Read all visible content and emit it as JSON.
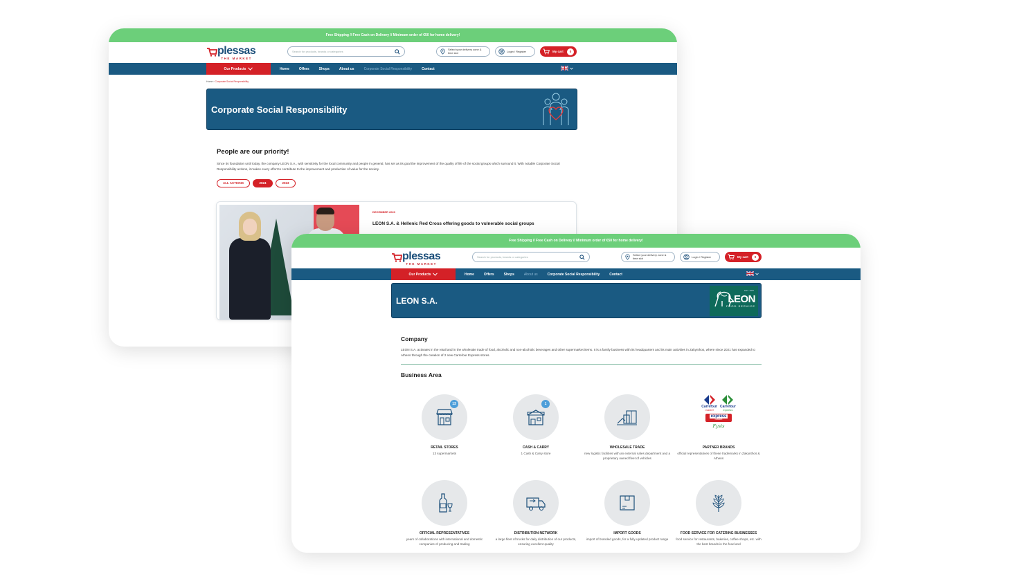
{
  "colors": {
    "promo_green": "#6ccf7a",
    "nav_blue": "#1a5a82",
    "brand_red": "#d42127",
    "badge_blue": "#4d9ed9"
  },
  "header": {
    "promo": "Free Shipping // Free Cash on Delivery // Minimum order of €50 for home delivery!",
    "logo_word": "plessas",
    "logo_sub": "THE MARKET",
    "search_placeholder": "Search for products, brands or categories",
    "delivery_label": "Select your delivery zone & time slot",
    "login_label": "Login / Register",
    "cart_label": "My cart",
    "cart_count": "0"
  },
  "nav": {
    "products": "Our Products",
    "links": [
      "Home",
      "Offers",
      "Shops",
      "About us",
      "Corporate Social Responsibility",
      "Contact"
    ]
  },
  "csr_page": {
    "breadcrumb_home": "Home",
    "breadcrumb_current": "Corporate Social Responsibility",
    "banner_title": "Corporate Social Responsibility",
    "heading": "People are our priority!",
    "intro": "Since its foundation until today, the company LEON S.A., with sensitivity for the local community and people in general, has set as its goal the improvement of the quality of life of the social groups which surround it. With notable Corporate Social Responsibility actions, it makes every effort to contribute to the improvement and production of value for the society.",
    "filters": [
      "ALL ACTIONS",
      "2024",
      "2023"
    ],
    "card_date": "DECEMBER 2023",
    "card_title": "LEON S.A. & Hellenic Red Cross offering goods to vulnerable social groups"
  },
  "leon_page": {
    "banner_title": "LEON S.A.",
    "logo_word": "LEON",
    "logo_sub": "FOOD SERVICE",
    "logo_est": "EST. 1987",
    "company_heading": "Company",
    "company_text": "LEON S.A. activates in the retail and in the wholesale trade of food, alcoholic and non-alcoholic beverages and other supermarket items. It is a family business with its headquarters and its main activities in Zakynthos, where since 2021 has expanded to Athens through the creation of 2 new Carrefour Express stores.",
    "business_heading": "Business Area",
    "items": [
      {
        "label": "RETAIL STORES",
        "desc": "13 supermarkets",
        "badge": "13",
        "icon": "store-icon"
      },
      {
        "label": "CASH & CARRY",
        "desc": "1 Cash & Carry store",
        "badge": "1",
        "icon": "warehouse-icon"
      },
      {
        "label": "WHOLESALE TRADE",
        "desc": "new logistic facilities with an external sales department and a proprietary owned fleet of vehicles",
        "icon": "wholesale-icon"
      },
      {
        "label": "PARTNER BRANDS",
        "desc": "official representatives of these trademarks in Zakynthos & Athens",
        "icon": "brands-logos"
      },
      {
        "label": "OFFICIAL REPRESENTATIVES",
        "desc": "years of collaborations with international and domestic companies of producing and trading",
        "icon": "bottle-icon"
      },
      {
        "label": "DISTRIBUTION NETWORK",
        "desc": "a large fleet of trucks for daily distribution of our products, ensuring excellent quality",
        "icon": "truck-icon"
      },
      {
        "label": "IMPORT GOODS",
        "desc": "import of branded goods, for a fully updated product range",
        "icon": "box-icon"
      },
      {
        "label": "FOOD SERVICE FOR CATERING BUSINESSES",
        "desc": "food service for restaurants, bakeries, coffee shops, etc. with the best brands in the food and",
        "icon": "wheat-icon"
      }
    ],
    "brands": {
      "carrefour": "Carrefour",
      "market": "market",
      "express": "express",
      "express_big": "express",
      "express_small": "market",
      "fysis": "Fysis"
    }
  }
}
